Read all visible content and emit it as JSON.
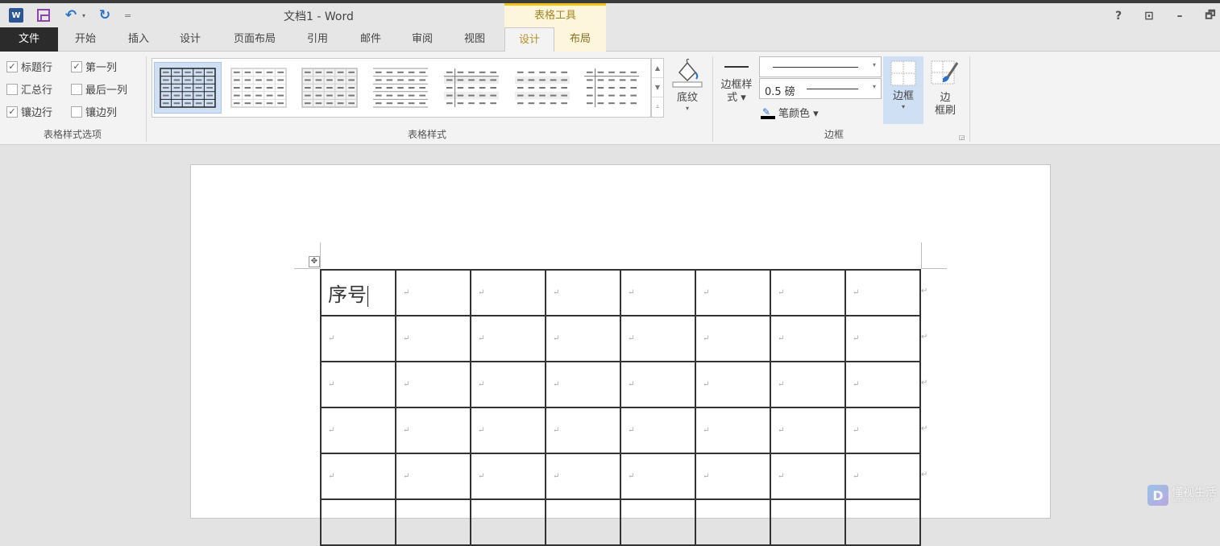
{
  "window": {
    "title": "文档1 - Word",
    "controls": {
      "help": "?",
      "ribbon_display": "⊡",
      "minimize": "–",
      "restore": "🗗"
    }
  },
  "qat": {
    "word_icon_label": "W",
    "save": "save-icon",
    "undo_glyph": "↶",
    "redo_glyph": "↻",
    "customize_glyph": "="
  },
  "contextual": {
    "header": "表格工具"
  },
  "tabs": [
    {
      "label": "文件"
    },
    {
      "label": "开始"
    },
    {
      "label": "插入"
    },
    {
      "label": "设计"
    },
    {
      "label": "页面布局"
    },
    {
      "label": "引用"
    },
    {
      "label": "邮件"
    },
    {
      "label": "审阅"
    },
    {
      "label": "视图"
    },
    {
      "label": "设计",
      "active": true,
      "contextual": true
    },
    {
      "label": "布局",
      "contextual": true
    }
  ],
  "ribbon": {
    "style_options": {
      "label": "表格样式选项",
      "options": [
        {
          "label": "标题行",
          "checked": true
        },
        {
          "label": "第一列",
          "checked": true
        },
        {
          "label": "汇总行",
          "checked": false
        },
        {
          "label": "最后一列",
          "checked": false
        },
        {
          "label": "镶边行",
          "checked": true
        },
        {
          "label": "镶边列",
          "checked": false
        }
      ]
    },
    "table_styles": {
      "label": "表格样式",
      "gallery_count": 7,
      "selected_index": 0
    },
    "shading": {
      "label": "底纹",
      "caret": "▾"
    },
    "borders": {
      "label": "边框",
      "border_styles_label_1": "边框样",
      "border_styles_label_2": "式 ▾",
      "line_weight": "0.5 磅",
      "pen_color": "笔颜色 ▾",
      "borders_button": "边框",
      "borders_caret": "▾",
      "painter_label_1": "边",
      "painter_label_2": "框刷"
    }
  },
  "document": {
    "table": {
      "rows": [
        [
          "序号",
          "↵",
          "↵",
          "↵",
          "↵",
          "↵",
          "↵",
          "↵"
        ],
        [
          "↵",
          "↵",
          "↵",
          "↵",
          "↵",
          "↵",
          "↵",
          "↵"
        ],
        [
          "↵",
          "↵",
          "↵",
          "↵",
          "↵",
          "↵",
          "↵",
          "↵"
        ],
        [
          "↵",
          "↵",
          "↵",
          "↵",
          "↵",
          "↵",
          "↵",
          "↵"
        ],
        [
          "↵",
          "↵",
          "↵",
          "↵",
          "↵",
          "↵",
          "↵",
          "↵"
        ],
        [
          "",
          "",
          "",
          "",
          "",
          "",
          "",
          ""
        ]
      ],
      "row_end_mark": "↵",
      "move_handle": "✥"
    }
  },
  "watermark": {
    "cn": "懂视生活",
    "en": "SIDONGSHI.COM",
    "logo": "D"
  }
}
